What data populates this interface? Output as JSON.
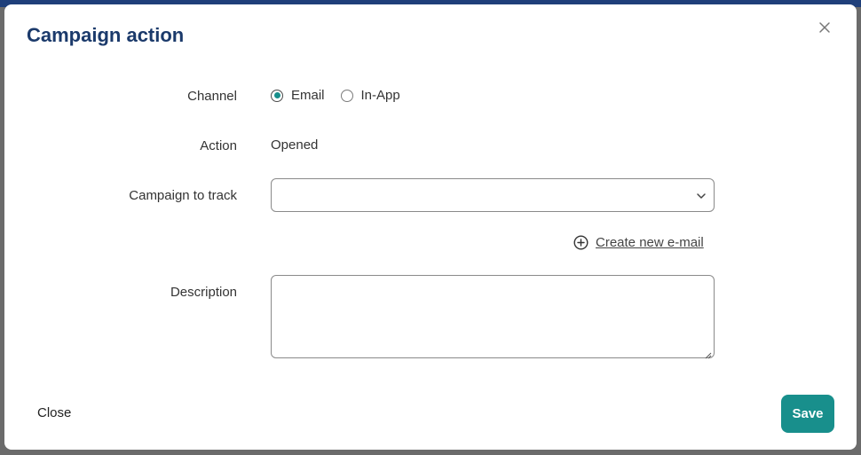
{
  "dialog": {
    "title": "Campaign action",
    "close_icon": "close-icon"
  },
  "form": {
    "channel": {
      "label": "Channel",
      "options": [
        {
          "label": "Email",
          "selected": true
        },
        {
          "label": "In-App",
          "selected": false
        }
      ]
    },
    "action": {
      "label": "Action",
      "value": "Opened"
    },
    "campaign": {
      "label": "Campaign to track",
      "value": "",
      "icon": "chevron-down-icon"
    },
    "create_link": {
      "label": "Create new e-mail",
      "icon": "plus-circle-icon"
    },
    "description": {
      "label": "Description",
      "value": ""
    }
  },
  "footer": {
    "close_label": "Close",
    "save_label": "Save"
  },
  "colors": {
    "accent": "#188f8c",
    "title": "#1b3a6b",
    "backdrop": "#6b6b6b"
  }
}
